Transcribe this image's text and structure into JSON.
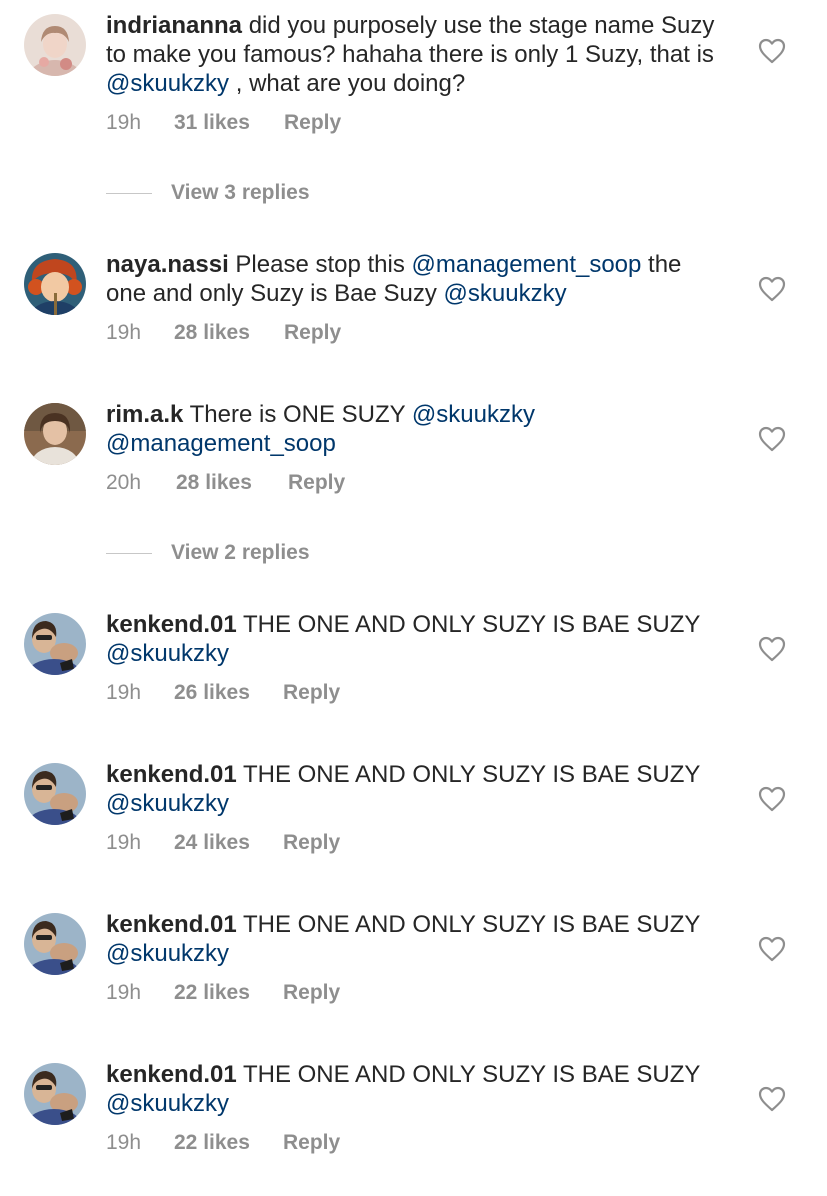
{
  "comments": [
    {
      "username": "indriananna",
      "text_parts": [
        "did you purposely use the stage name Suzy to make you famous? hahaha there is only 1 Suzy, that is ",
        "@skuukzky",
        " , what are you doing?"
      ],
      "time": "19h",
      "likes": "31 likes",
      "reply": "Reply",
      "view_replies": "View 3 replies"
    },
    {
      "username": "naya.nassi",
      "text_parts": [
        "Please stop this ",
        "@management_soop",
        " the one and only Suzy is Bae Suzy ",
        "@skuukzky"
      ],
      "time": "19h",
      "likes": "28 likes",
      "reply": "Reply"
    },
    {
      "username": "rim.a.k",
      "text_parts": [
        "There is ONE SUZY ",
        "@skuukzky",
        "\n",
        "@management_soop"
      ],
      "time": "20h",
      "likes": "28 likes",
      "reply": "Reply",
      "view_replies": "View 2 replies"
    },
    {
      "username": "kenkend.01",
      "text_parts": [
        "THE ONE AND ONLY SUZY IS BAE SUZY\n",
        "@skuukzky"
      ],
      "time": "19h",
      "likes": "26 likes",
      "reply": "Reply"
    },
    {
      "username": "kenkend.01",
      "text_parts": [
        "THE ONE AND ONLY SUZY IS BAE SUZY\n",
        "@skuukzky"
      ],
      "time": "19h",
      "likes": "24 likes",
      "reply": "Reply"
    },
    {
      "username": "kenkend.01",
      "text_parts": [
        "THE ONE AND ONLY SUZY IS BAE SUZY\n",
        "@skuukzky"
      ],
      "time": "19h",
      "likes": "22 likes",
      "reply": "Reply"
    },
    {
      "username": "kenkend.01",
      "text_parts": [
        "THE ONE AND ONLY SUZY IS BAE SUZY\n",
        "@skuukzky"
      ],
      "time": "19h",
      "likes": "22 likes",
      "reply": "Reply"
    }
  ],
  "icons": {
    "like": "heart-outline-icon"
  },
  "colors": {
    "text": "#262626",
    "mention": "#00376b",
    "meta": "#8e8e8e"
  }
}
